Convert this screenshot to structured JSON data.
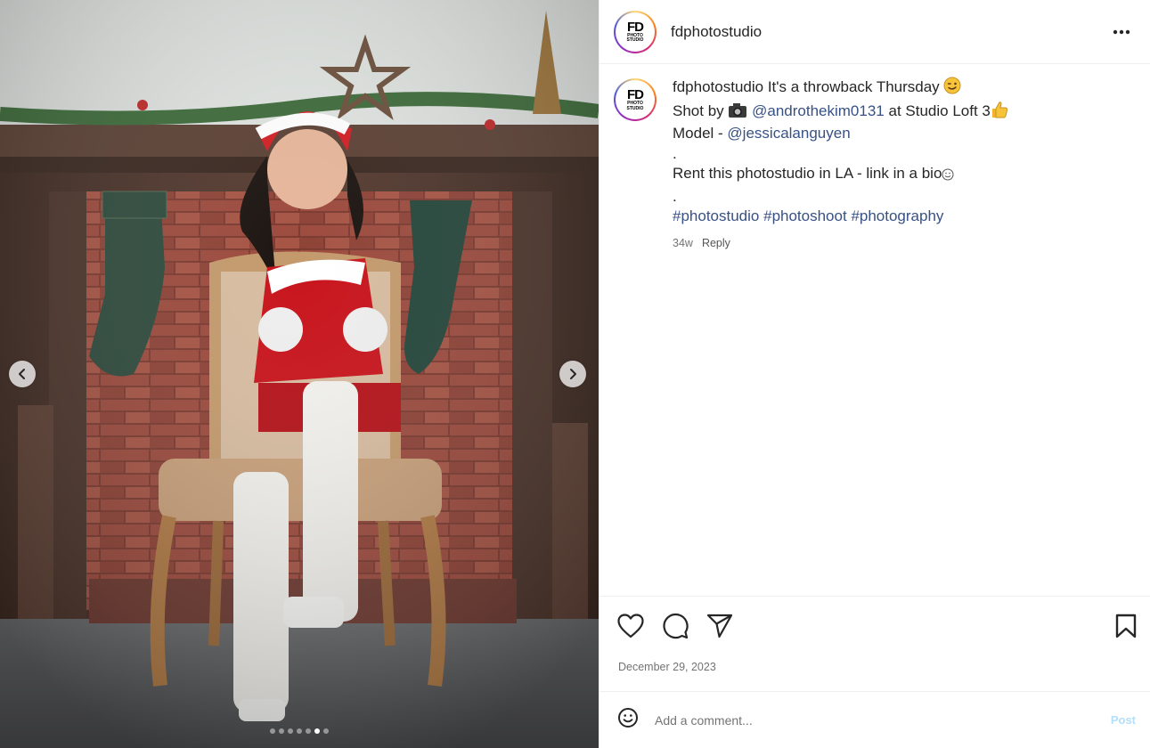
{
  "post": {
    "username": "fdphotostudio",
    "avatar": {
      "line1": "FD",
      "line2": "PHOTO",
      "line3": "STUDIO"
    },
    "image_alt": "Model in red santa outfit and white boots sitting on an ornate chair in front of a decorated brick fireplace",
    "carousel": {
      "total": 7,
      "active_index": 5
    }
  },
  "caption": {
    "username": "fdphotostudio",
    "line1_text": "It's a throwback Thursday",
    "line1_emoji": "wink-face-emoji",
    "line2_prefix": "Shot by",
    "line2_emoji": "camera-emoji",
    "photographer": "@androthekim0131",
    "line2_suffix": "at Studio Loft 3",
    "line2_emoji_end": "thumbs-up-emoji",
    "line3_prefix": "Model -",
    "model": "@jessicalanguyen",
    "dot1": ".",
    "line5_text": "Rent this photostudio in LA - link in a bio",
    "line5_emoji": "smile-face-emoji",
    "dot2": ".",
    "hashtags": [
      "#photostudio",
      "#photoshoot",
      "#photography"
    ],
    "age": "34w",
    "reply_label": "Reply"
  },
  "actions": {
    "like": "heart-icon",
    "comment": "comment-icon",
    "share": "share-icon",
    "save": "bookmark-icon"
  },
  "date": "December 29, 2023",
  "comment_box": {
    "placeholder": "Add a comment...",
    "post_label": "Post"
  },
  "colors": {
    "link": "#385185",
    "muted": "#737373",
    "post_disabled": "#b2dffc",
    "border": "#efefef"
  }
}
